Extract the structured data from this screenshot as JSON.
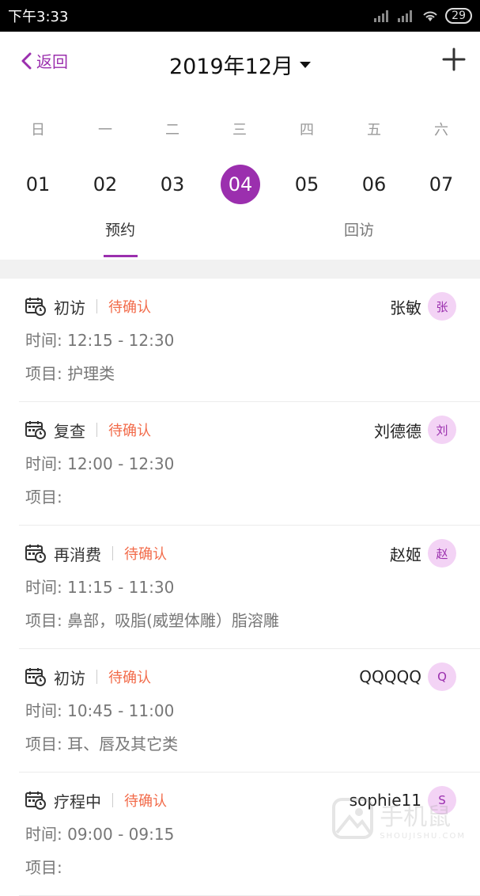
{
  "status_bar": {
    "time": "下午3:33",
    "battery": "29"
  },
  "header": {
    "back_label": "返回",
    "month_title": "2019年12月"
  },
  "weekdays": [
    "日",
    "一",
    "二",
    "三",
    "四",
    "五",
    "六"
  ],
  "dates": [
    "01",
    "02",
    "03",
    "04",
    "05",
    "06",
    "07"
  ],
  "selected_date": "04",
  "tabs": [
    {
      "label": "预约",
      "active": true
    },
    {
      "label": "回访",
      "active": false
    }
  ],
  "labels": {
    "time": "时间:",
    "project": "项目:"
  },
  "appointments": [
    {
      "type": "初访",
      "status": "待确认",
      "name": "张敏",
      "avatar": "张",
      "time": "12:15 - 12:30",
      "project": "护理类"
    },
    {
      "type": "复查",
      "status": "待确认",
      "name": "刘德德",
      "avatar": "刘",
      "time": "12:00 - 12:30",
      "project": ""
    },
    {
      "type": "再消费",
      "status": "待确认",
      "name": "赵姬",
      "avatar": "赵",
      "time": "11:15 - 11:30",
      "project": "鼻部，吸脂(威塑体雕）脂溶雕"
    },
    {
      "type": "初访",
      "status": "待确认",
      "name": "QQQQQ",
      "avatar": "Q",
      "time": "10:45 - 11:00",
      "project": "耳、唇及其它类"
    },
    {
      "type": "疗程中",
      "status": "待确认",
      "name": "sophie11",
      "avatar": "S",
      "time": "09:00 - 09:15",
      "project": ""
    }
  ],
  "watermark": {
    "text": "手机鼠",
    "sub": "SHOUJISHU.COM"
  },
  "colors": {
    "accent": "#9B2FAE",
    "status": "#F26B4A",
    "avatar_bg": "#F3D3F5"
  }
}
